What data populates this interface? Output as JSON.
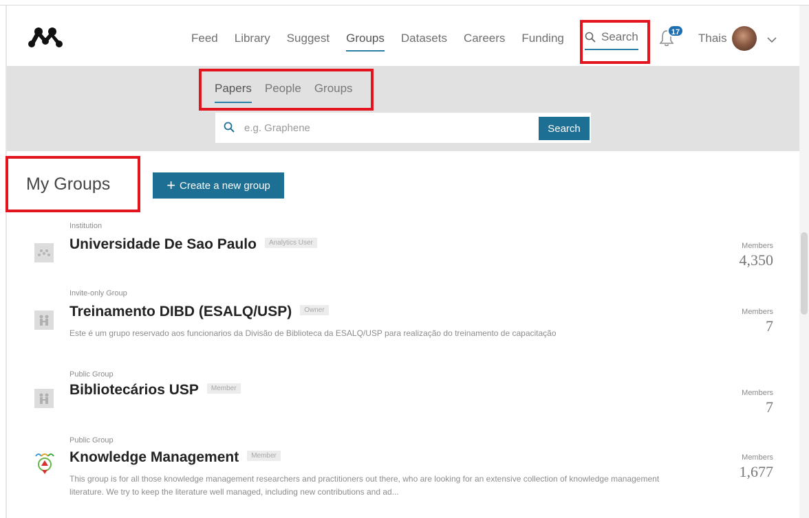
{
  "nav": {
    "items": [
      {
        "label": "Feed",
        "active": false
      },
      {
        "label": "Library",
        "active": false
      },
      {
        "label": "Suggest",
        "active": false
      },
      {
        "label": "Groups",
        "active": true
      },
      {
        "label": "Datasets",
        "active": false
      },
      {
        "label": "Careers",
        "active": false
      },
      {
        "label": "Funding",
        "active": false
      }
    ],
    "search_label": "Search",
    "notification_count": "17",
    "user_name": "Thais"
  },
  "search_band": {
    "tabs": [
      {
        "label": "Papers",
        "active": true
      },
      {
        "label": "People",
        "active": false
      },
      {
        "label": "Groups",
        "active": false
      }
    ],
    "placeholder": "e.g. Graphene",
    "button_label": "Search"
  },
  "main": {
    "title": "My Groups",
    "create_button_label": "Create a new group",
    "members_label": "Members",
    "groups": [
      {
        "type": "Institution",
        "name": "Universidade De Sao Paulo",
        "role": "Analytics User",
        "description": "",
        "members": "4,350",
        "icon": "institution-logo-icon"
      },
      {
        "type": "Invite-only Group",
        "name": "Treinamento DIBD (ESALQ/USP)",
        "role": "Owner",
        "description": "Este é um grupo reservado aos funcionarios da Divisão de Biblioteca da ESALQ/USP para realização do treinamento de capacitação",
        "members": "7",
        "icon": "people-group-icon"
      },
      {
        "type": "Public Group",
        "name": "Bibliotecários USP",
        "role": "Member",
        "description": "",
        "members": "7",
        "icon": "people-group-icon"
      },
      {
        "type": "Public Group",
        "name": "Knowledge Management",
        "role": "Member",
        "description": "This group is for all those knowledge management researchers and practitioners out there, who are looking for an extensive collection of knowledge management literature. We try to keep the literature well managed, including new contributions and ad...",
        "members": "1,677",
        "icon": "knowledge-management-logo-icon"
      }
    ]
  },
  "colors": {
    "accent": "#1e6f94",
    "underline": "#2a7ea6",
    "band": "#e1e1e1",
    "annotation": "#e3141e",
    "badge": "#1f6fb0"
  }
}
